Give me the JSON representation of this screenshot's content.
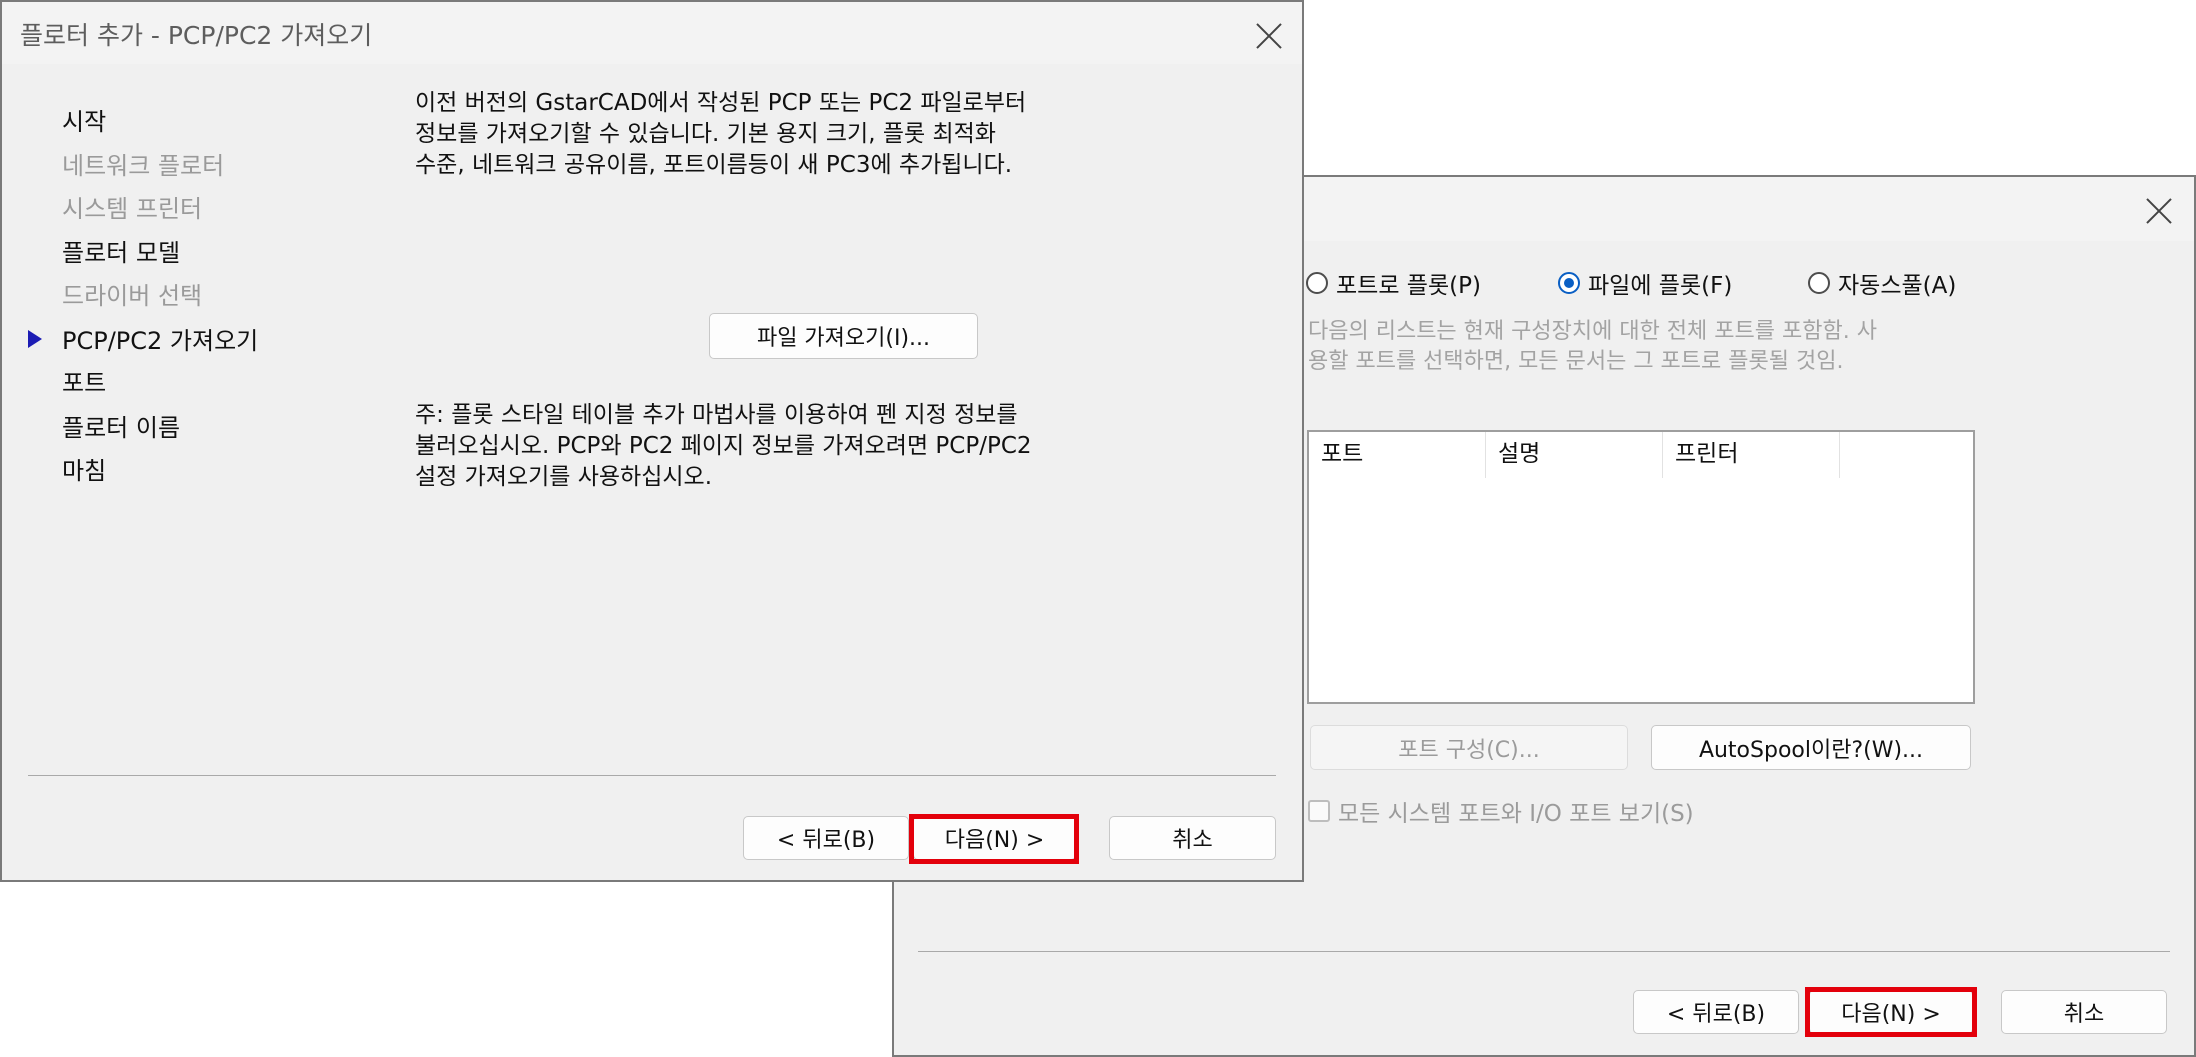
{
  "dialog1": {
    "title": "플로터 추가 - PCP/PC2 가져오기",
    "steps": [
      {
        "label": "시작",
        "state": "enabled"
      },
      {
        "label": "네트워크 플로터",
        "state": "disabled"
      },
      {
        "label": "시스템 프린터",
        "state": "disabled"
      },
      {
        "label": "플로터 모델",
        "state": "enabled"
      },
      {
        "label": "드라이버 선택",
        "state": "disabled"
      },
      {
        "label": "PCP/PC2 가져오기",
        "state": "current"
      },
      {
        "label": "포트",
        "state": "enabled"
      },
      {
        "label": "플로터 이름",
        "state": "enabled"
      },
      {
        "label": "마침",
        "state": "enabled"
      }
    ],
    "intro_text": "이전 버전의 GstarCAD에서 작성된 PCP 또는 PC2 파일로부터\n정보를 가져오기할 수 있습니다. 기본 용지 크기, 플롯 최적화\n수준, 네트워크 공유이름, 포트이름등이 새 PC3에 추가됩니다.",
    "import_button": "파일 가져오기(I)...",
    "note_text": "주: 플롯 스타일 테이블 추가 마법사를 이용하여 펜 지정 정보를\n불러오십시오. PCP와 PC2 페이지 정보를 가져오려면 PCP/PC2\n설정 가져오기를 사용하십시오.",
    "back_button": "< 뒤로(B)",
    "next_button": "다음(N) >",
    "cancel_button": "취소"
  },
  "dialog2": {
    "radios": [
      {
        "label": "포트로 플롯(P)",
        "selected": false
      },
      {
        "label": "파일에 플롯(F)",
        "selected": true
      },
      {
        "label": "자동스풀(A)",
        "selected": false
      }
    ],
    "info_text": "다음의 리스트는 현재 구성장치에 대한 전체 포트를 포함함. 사\n용할 포트를 선택하면, 모든 문서는 그 포트로 플롯될 것임.",
    "columns": [
      "포트",
      "설명",
      "프린터",
      ""
    ],
    "configure_button": "포트 구성(C)...",
    "autospool_button": "AutoSpool이란?(W)...",
    "show_all_checkbox": "모든 시스템 포트와 I/O 포트 보기(S)",
    "back_button": "< 뒤로(B)",
    "next_button": "다음(N) >",
    "cancel_button": "취소"
  },
  "colors": {
    "highlight": "#e3000b",
    "dialog_bg": "#f0f0f0",
    "current_arrow": "#1c1cb4",
    "radio_selected": "#0a5fc4"
  },
  "icons": [
    "close-icon",
    "step-arrow-icon"
  ]
}
